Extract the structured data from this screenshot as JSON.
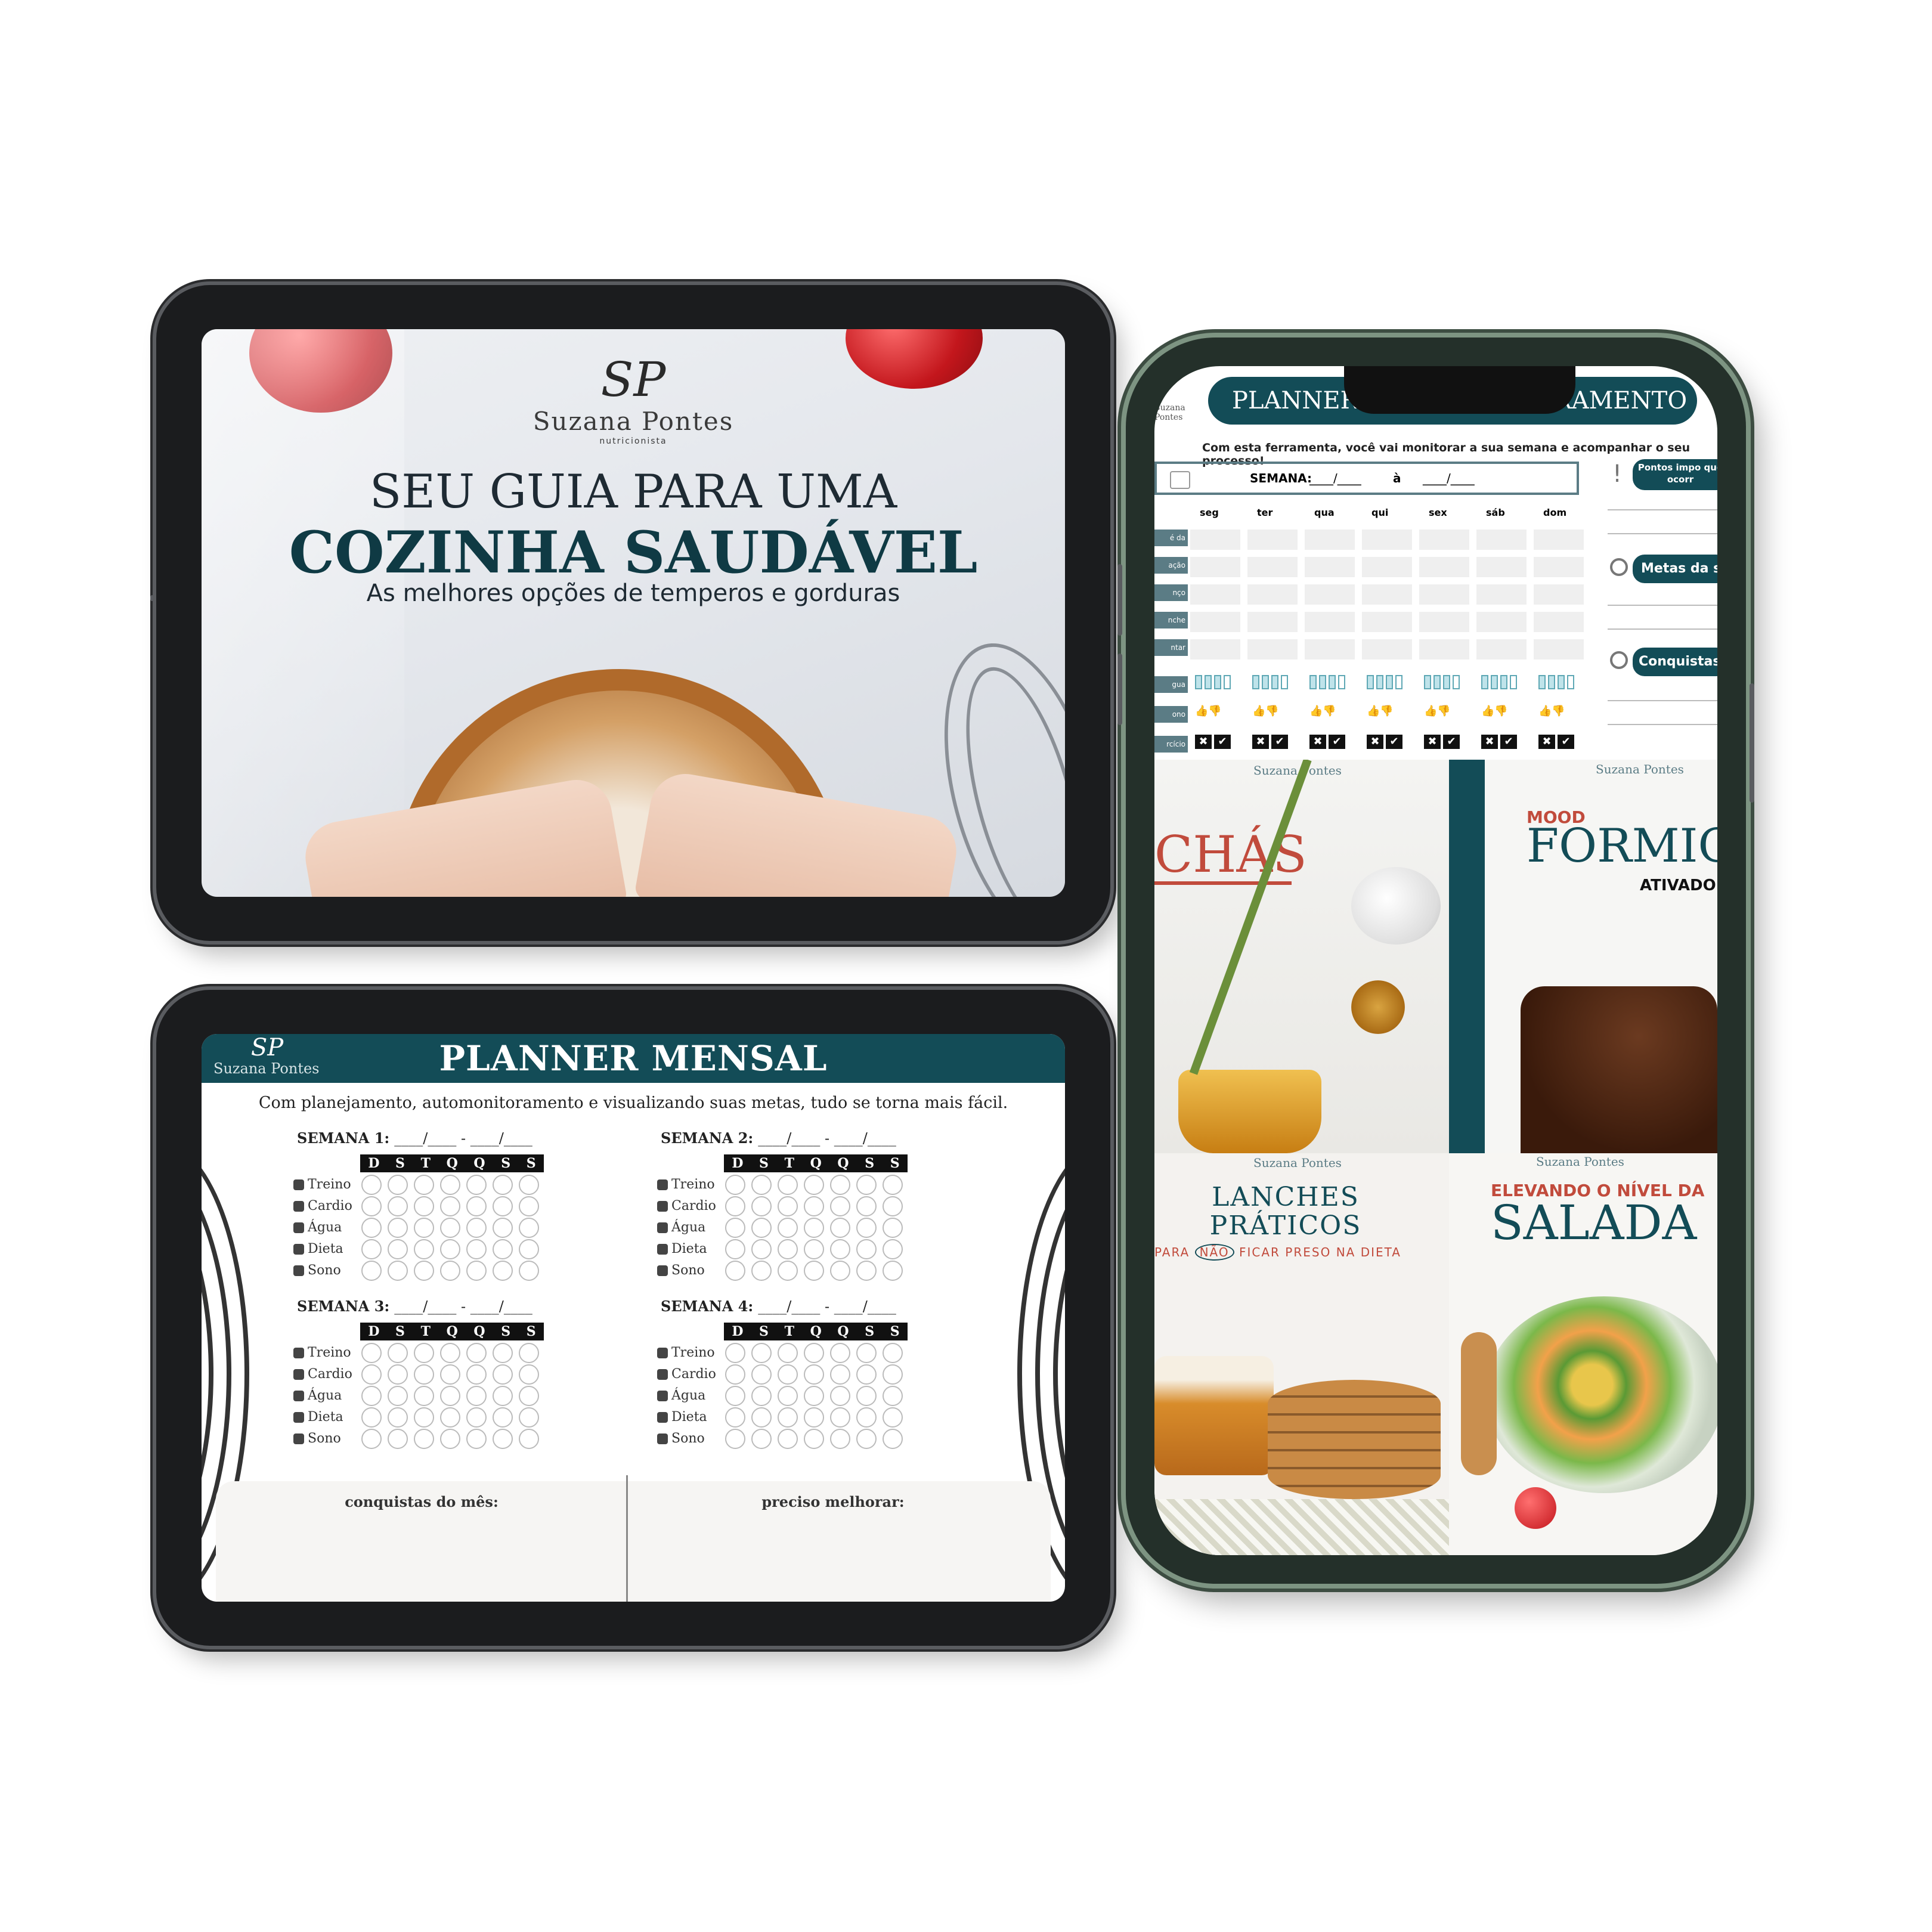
{
  "tablet_cover": {
    "brand_monogram": "SP",
    "brand_name": "Suzana Pontes",
    "brand_tagline": "nutricionista",
    "title_line1": "SEU GUIA PARA UMA",
    "title_line2": "COZINHA SAUDÁVEL",
    "subtitle": "As melhores opções de temperos e gorduras"
  },
  "tablet_planner": {
    "brand_monogram": "SP",
    "brand_name": "Suzana Pontes",
    "title": "PLANNER MENSAL",
    "subtitle": "Com planejamento, automonitoramento e visualizando suas metas, tudo se torna mais fácil.",
    "day_letters": [
      "D",
      "S",
      "T",
      "Q",
      "Q",
      "S",
      "S"
    ],
    "row_labels": [
      "Treino",
      "Cardio",
      "Água",
      "Dieta",
      "Sono"
    ],
    "weeks": [
      {
        "label": "SEMANA 1:",
        "blank": "____/____ - ____/____"
      },
      {
        "label": "SEMANA 2:",
        "blank": "____/____ - ____/____"
      },
      {
        "label": "SEMANA 3:",
        "blank": "____/____ - ____/____"
      },
      {
        "label": "SEMANA 4:",
        "blank": "____/____ - ____/____"
      }
    ],
    "box_left": "conquistas do mês:",
    "box_right": "preciso melhorar:"
  },
  "phone": {
    "monitor_title_left": "PLANNER",
    "monitor_title_right": "TORAMENTO",
    "monitor_brand": "Suzana Pontes",
    "monitor_subtitle": "Com esta ferramenta, você vai monitorar a sua semana e acompanhar o seu processo!",
    "week_label": "SEMANA:",
    "week_blank1": "____/____",
    "week_sep": "à",
    "week_blank2": "____/____",
    "days": [
      "seg",
      "ter",
      "qua",
      "qui",
      "sex",
      "sáb",
      "dom"
    ],
    "meal_rows": [
      "é da nhã",
      "ação",
      "nço",
      "nche",
      "ntar"
    ],
    "tracker_rows": [
      "gua",
      "ono",
      "rcício"
    ],
    "side_important": "Pontos impo que ocorr",
    "side_goals": "Metas da s",
    "side_wins": "Conquistas d",
    "tile_chas": "CHÁS",
    "tile_mood_small": "MOOD",
    "tile_mood_big": "FORMIG",
    "tile_mood_ativado": "ATIVADO",
    "tile_lanches_1": "LANCHES",
    "tile_lanches_2": "PRÁTICOS",
    "tile_lanches_3a": "PARA",
    "tile_lanches_3b": "NÃO",
    "tile_lanches_3c": "FICAR PRESO NA DIETA",
    "tile_salada_1": "ELEVANDO O NÍVEL DA",
    "tile_salada_2": "SALADA",
    "tile_brand": "Suzana Pontes"
  },
  "colors": {
    "teal": "#134c57",
    "accent_red": "#c14b3c",
    "device_frame": "#1b1c1e",
    "phone_frame": "#24302a"
  }
}
